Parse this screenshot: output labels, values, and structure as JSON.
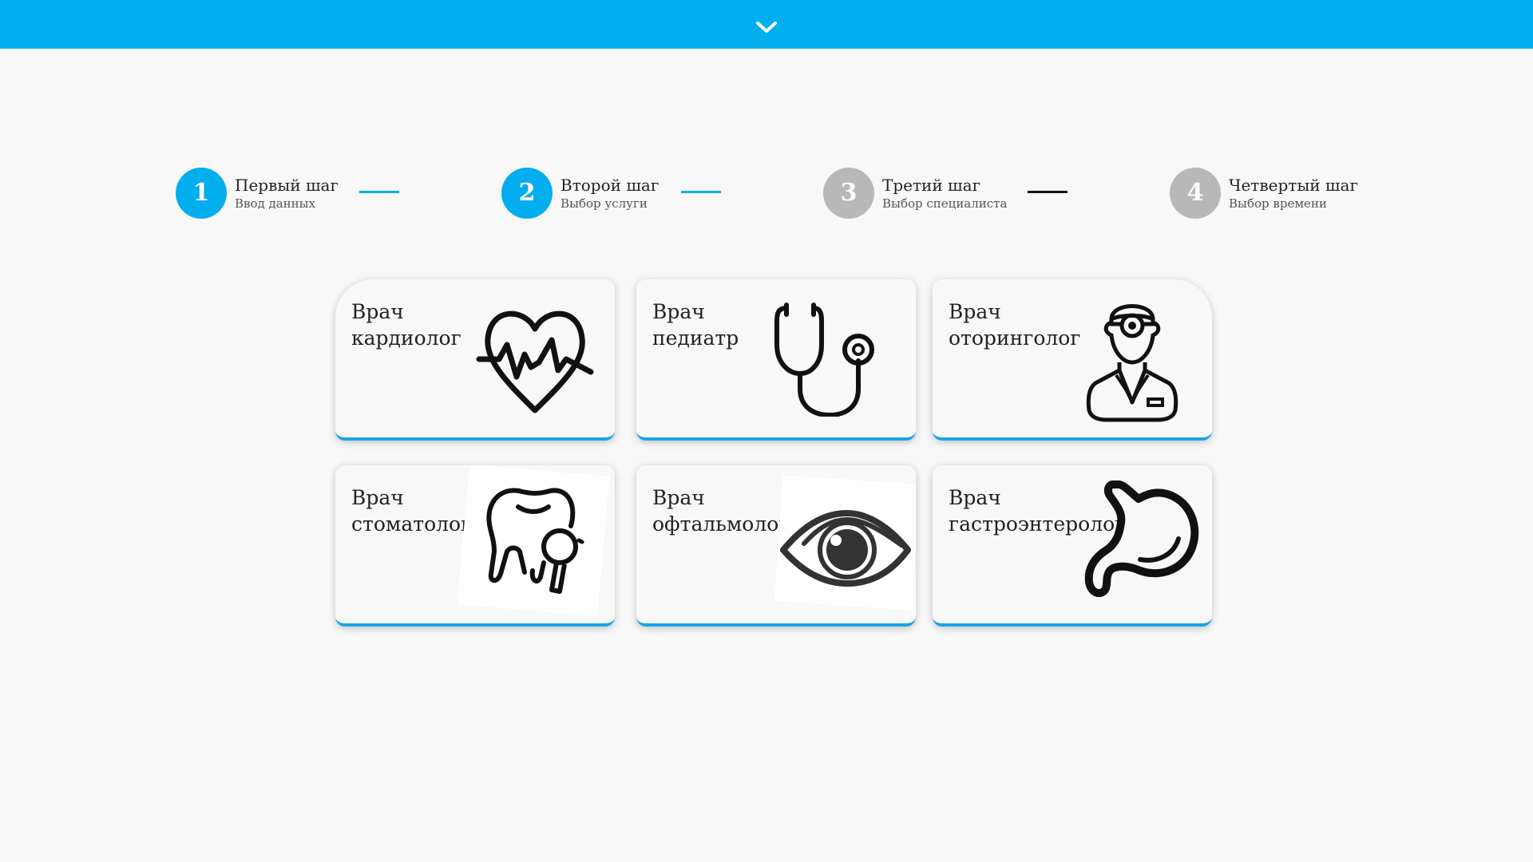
{
  "header": {
    "toggle_icon": "chevron-down-icon",
    "color": "#03aeef"
  },
  "steps": [
    {
      "number": "1",
      "title": "Первый шаг",
      "subtitle": "Ввод данных",
      "state": "active"
    },
    {
      "number": "2",
      "title": "Второй шаг",
      "subtitle": "Выбор услуги",
      "state": "active"
    },
    {
      "number": "3",
      "title": "Третий шаг",
      "subtitle": "Выбор специалиста",
      "state": "inactive"
    },
    {
      "number": "4",
      "title": "Четвертый шаг",
      "subtitle": "Выбор времени",
      "state": "inactive"
    }
  ],
  "services": [
    {
      "line1": "Врач",
      "line2": "кардиолог",
      "icon": "heart-pulse-icon"
    },
    {
      "line1": "Врач",
      "line2": "педиатр",
      "icon": "stethoscope-icon"
    },
    {
      "line1": "Врач",
      "line2": "оторинголог",
      "icon": "ent-doctor-icon"
    },
    {
      "line1": "Врач",
      "line2": "стоматолог",
      "icon": "tooth-mirror-icon"
    },
    {
      "line1": "Врач",
      "line2": "офтальмолог",
      "icon": "eye-icon"
    },
    {
      "line1": "Врач",
      "line2": "гастроэнтеролог",
      "icon": "stomach-icon"
    }
  ],
  "colors": {
    "accent": "#03aeef",
    "inactive_step": "#b8b8b8",
    "card_border": "#1aa5e6"
  }
}
